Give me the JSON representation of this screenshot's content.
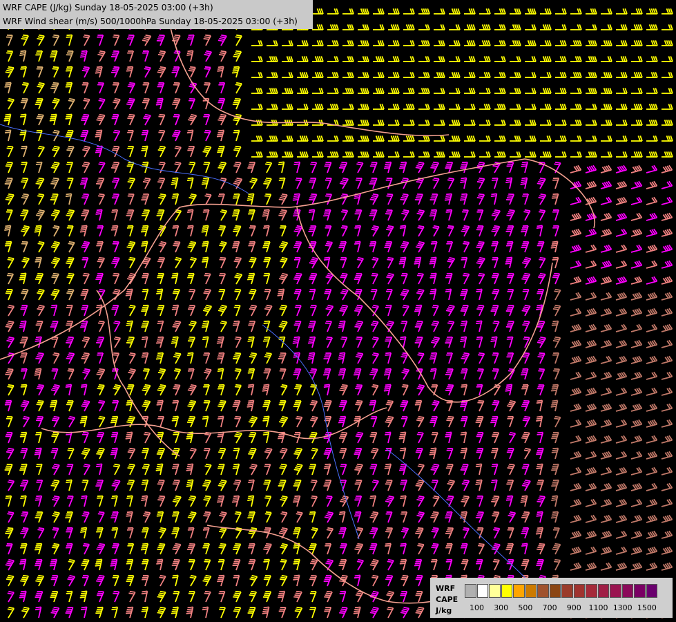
{
  "header": {
    "line1": "WRF CAPE (J/kg) Sunday 18-05-2025 03:00 (+3h)",
    "line2": "WRF Wind shear (m/s) 500/1000hPa Sunday 18-05-2025 03:00 (+3h)"
  },
  "legend": {
    "label_line1": "WRF",
    "label_line2": "CAPE",
    "label_line3": "J/kg",
    "colors": [
      "#b0b0b0",
      "#ffffff",
      "#ffff99",
      "#ffff00",
      "#ffa500",
      "#cc7a00",
      "#a0522d",
      "#8b4513",
      "#9a3b2a",
      "#a0332f",
      "#a52a3a",
      "#a01e46",
      "#9a1450",
      "#8b0a5a",
      "#7a0064",
      "#6a006e"
    ],
    "tick_labels": [
      "100",
      "300",
      "500",
      "700",
      "900",
      "1100",
      "1300",
      "1500"
    ]
  },
  "map": {
    "background_color": "#000000",
    "barb_colors": [
      "#ffff00",
      "#f08080",
      "#ff00ff",
      "#c07868",
      "#ddb070"
    ],
    "border_color": "#f4a090",
    "river_color": "#4a6fff"
  }
}
